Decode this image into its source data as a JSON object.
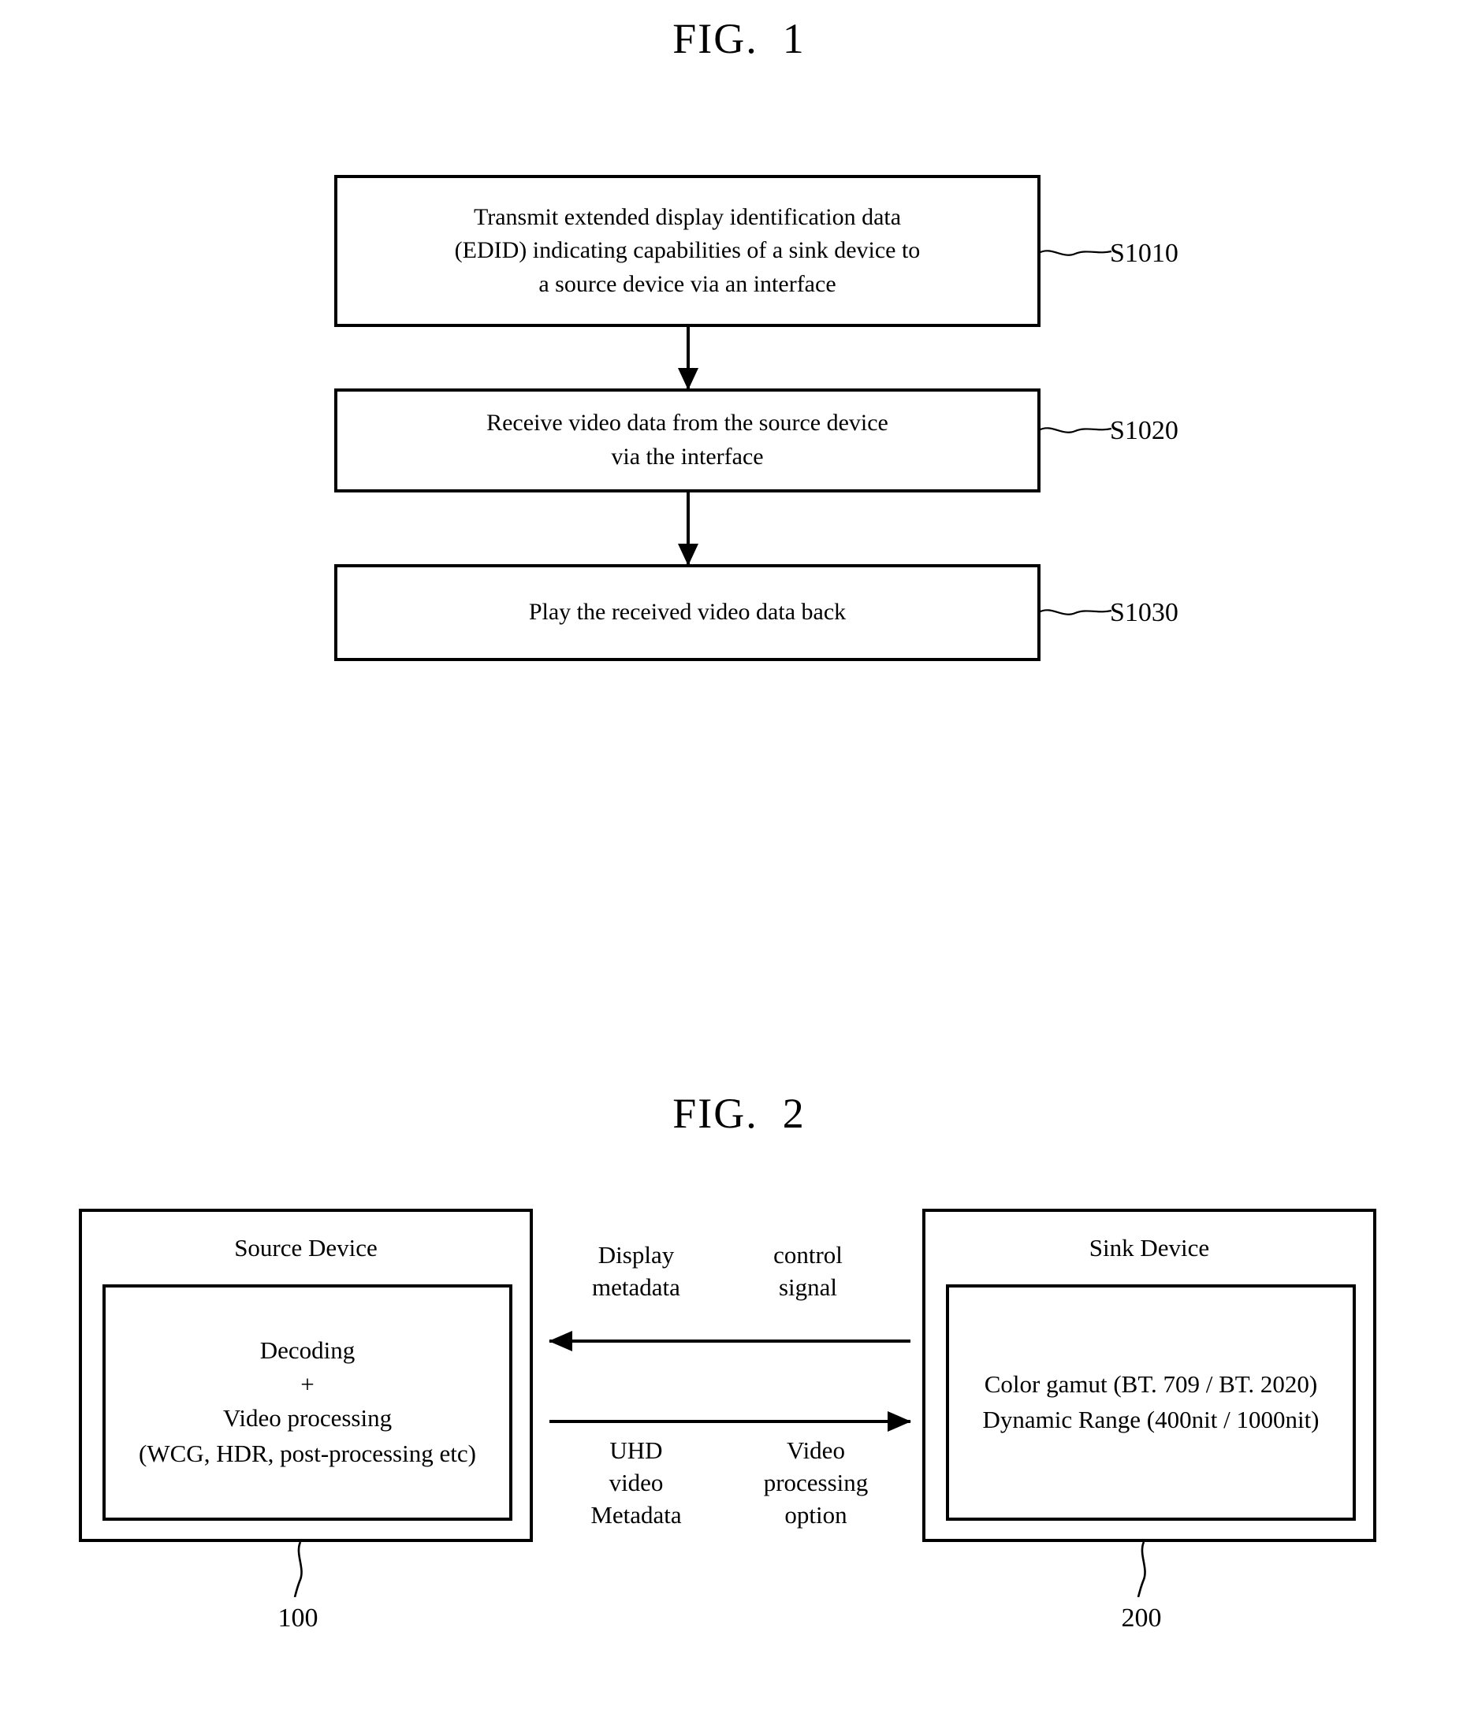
{
  "figures": [
    {
      "title": "FIG.  1",
      "type": "flowchart",
      "steps": [
        {
          "ref": "S1010",
          "lines": [
            "Transmit extended display identification data",
            "(EDID) indicating capabilities of a sink device to",
            "a source device via an interface"
          ]
        },
        {
          "ref": "S1020",
          "lines": [
            "Receive video data from the source device",
            "via the interface"
          ]
        },
        {
          "ref": "S1030",
          "lines": [
            "Play the received video data back"
          ]
        }
      ]
    },
    {
      "title": "FIG.  2",
      "type": "block-diagram",
      "blocks": [
        {
          "title": "Source Device",
          "ref": "100",
          "inner_lines": [
            "Decoding",
            "+",
            "Video processing",
            "(WCG, HDR, post-processing etc)"
          ]
        },
        {
          "title": "Sink Device",
          "ref": "200",
          "inner_lines": [
            "Color gamut (BT. 709 / BT. 2020)",
            "Dynamic Range (400nit / 1000nit)"
          ]
        }
      ],
      "connections": [
        {
          "direction": "sink-to-source",
          "labels": [
            {
              "lines": [
                "Display",
                "metadata"
              ]
            },
            {
              "lines": [
                "control",
                "signal"
              ]
            }
          ]
        },
        {
          "direction": "source-to-sink",
          "labels": [
            {
              "lines": [
                "UHD",
                "video",
                "Metadata"
              ]
            },
            {
              "lines": [
                "Video",
                "processing",
                "option"
              ]
            }
          ]
        }
      ]
    }
  ],
  "fig1": {
    "title": "FIG.  1",
    "s1010": {
      "ref": "S1010",
      "l1": "Transmit extended display identification data",
      "l2": "(EDID) indicating capabilities of a sink device to",
      "l3": "a source device via an interface"
    },
    "s1020": {
      "ref": "S1020",
      "l1": "Receive video data from the source device",
      "l2": "via the interface"
    },
    "s1030": {
      "ref": "S1030",
      "l1": "Play the received video data back"
    }
  },
  "fig2": {
    "title": "FIG.  2",
    "source": {
      "title": "Source Device",
      "ref": "100",
      "l1": "Decoding",
      "l2": "+",
      "l3": "Video processing",
      "l4": "(WCG, HDR, post-processing etc)"
    },
    "sink": {
      "title": "Sink Device",
      "ref": "200",
      "l1": "Color gamut (BT. 709 / BT. 2020)",
      "l2": "Dynamic Range (400nit / 1000nit)"
    },
    "mid": {
      "display_metadata_l1": "Display",
      "display_metadata_l2": "metadata",
      "control_signal_l1": "control",
      "control_signal_l2": "signal",
      "uhd_l1": "UHD",
      "uhd_l2": "video",
      "uhd_l3": "Metadata",
      "vpo_l1": "Video",
      "vpo_l2": "processing",
      "vpo_l3": "option"
    }
  },
  "colors": {
    "ink": "#000000",
    "paper": "#ffffff"
  }
}
